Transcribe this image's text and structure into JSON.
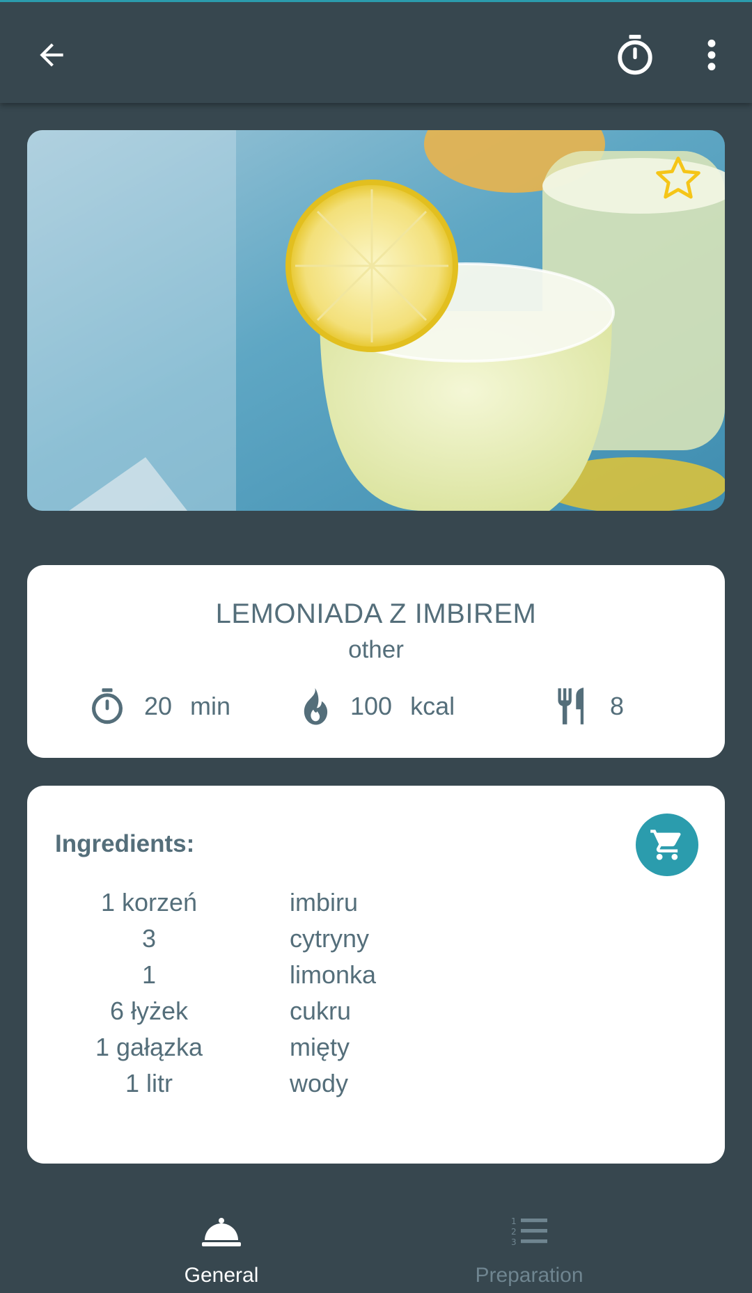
{
  "topbar": {
    "back_icon": "arrow-back-icon",
    "timer_icon": "stopwatch-icon",
    "menu_icon": "more-vert-icon"
  },
  "hero": {
    "image": "lemonade-glasses-photo",
    "favorite_icon": "star-outline-icon",
    "favorite_color": "#f5c518"
  },
  "recipe": {
    "title": "LEMONIADA Z IMBIREM",
    "category": "other",
    "time_value": "20",
    "time_unit": "min",
    "kcal_value": "100",
    "kcal_unit": "kcal",
    "servings": "8"
  },
  "ingredients": {
    "heading": "Ingredients:",
    "cart_icon": "shopping-cart-icon",
    "items": [
      {
        "qty": "1 korzeń",
        "name": "imbiru"
      },
      {
        "qty": "3",
        "name": "cytryny"
      },
      {
        "qty": "1",
        "name": "limonka"
      },
      {
        "qty": "6 łyżek",
        "name": "cukru"
      },
      {
        "qty": "1 gałązka",
        "name": "mięty"
      },
      {
        "qty": "1 litr",
        "name": "wody"
      }
    ]
  },
  "nav": {
    "general_label": "General",
    "preparation_label": "Preparation"
  },
  "colors": {
    "background": "#37474f",
    "accent": "#2b9cad",
    "text": "#546e7a"
  }
}
